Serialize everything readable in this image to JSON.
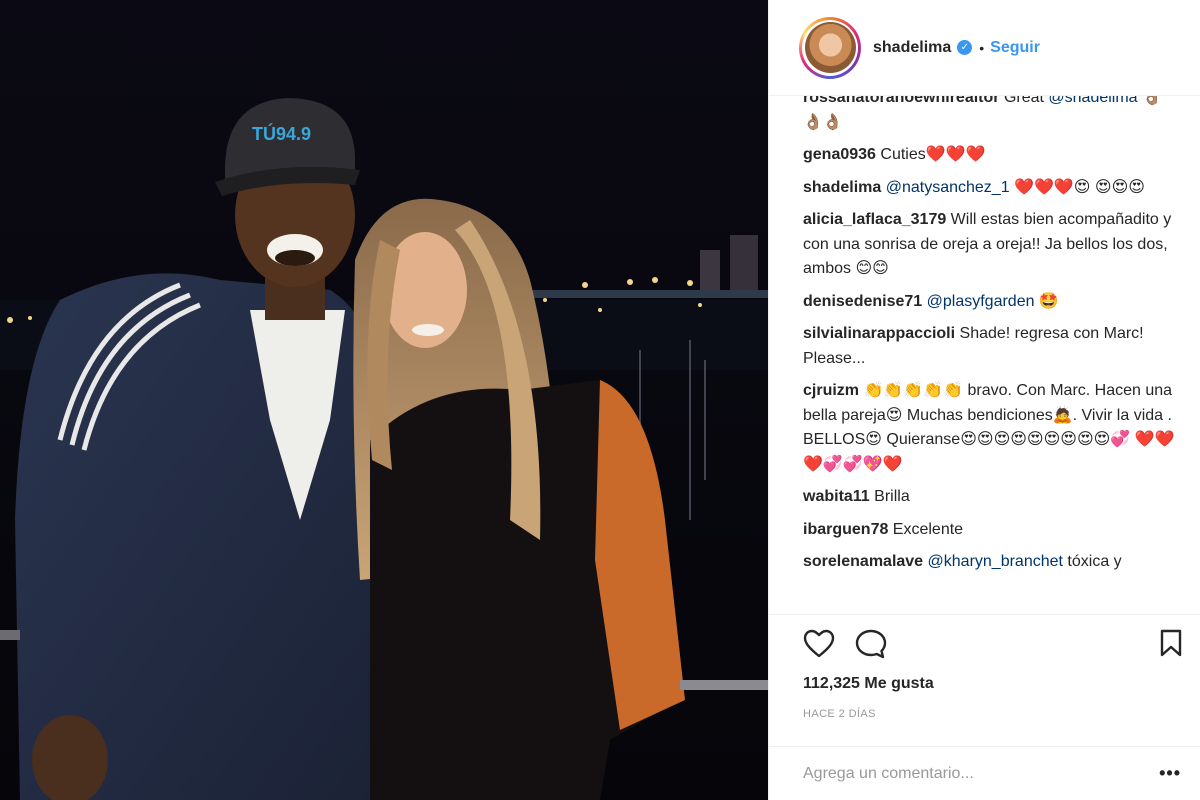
{
  "post": {
    "author": "shadelima",
    "follow_label": "Seguir",
    "separator": "•",
    "likes": "112,325 Me gusta",
    "timestamp": "HACE 2 DÍAS",
    "add_comment_placeholder": "Agrega un comentario...",
    "more_label": "•••",
    "photo_cap_text": "TÚ94.9"
  },
  "comments": [
    {
      "user": "rossanatoranoewhirealtor",
      "text": " Great ",
      "mention": "@shadelima",
      "after": " 👌🏽👌🏽👌🏽"
    },
    {
      "user": "gena0936",
      "text": " Cuties❤️❤️❤️",
      "mention": "",
      "after": ""
    },
    {
      "user": "shadelima",
      "text": " ",
      "mention": "@natysanchez_1",
      "after": " ❤️❤️❤️😍 😍😍😍"
    },
    {
      "user": "alicia_laflaca_3179",
      "text": " Will estas bien acompañadito y con una sonrisa de oreja a oreja!! Ja bellos los dos, ambos 😊😊",
      "mention": "",
      "after": ""
    },
    {
      "user": "denisedenise71",
      "text": " ",
      "mention": "@plasyfgarden",
      "after": " 🤩"
    },
    {
      "user": "silvialinarappaccioli",
      "text": " Shade! regresa con Marc! Please...",
      "mention": "",
      "after": ""
    },
    {
      "user": "cjruizm",
      "text": " 👏👏👏👏👏 bravo. Con Marc. Hacen una bella pareja😍 Muchas bendiciones🙇. Vivir la vida . BELLOS😍 Quieranse😍😍😍😍😍😍😍😍😍💞 ❤️❤️❤️💞💞💖❤️",
      "mention": "",
      "after": ""
    },
    {
      "user": "wabita11",
      "text": " Brilla",
      "mention": "",
      "after": ""
    },
    {
      "user": "ibarguen78",
      "text": " Excelente",
      "mention": "",
      "after": ""
    },
    {
      "user": "sorelenamalave",
      "text": " ",
      "mention": "@kharyn_branchet",
      "after": " tóxica y"
    }
  ],
  "colors": {
    "link": "#3897f0",
    "mention": "#003569",
    "muted": "#999999",
    "text": "#262626"
  },
  "icons": {
    "like": "heart-icon",
    "comment": "comment-bubble-icon",
    "save": "bookmark-icon",
    "verified": "verified-badge-icon"
  }
}
